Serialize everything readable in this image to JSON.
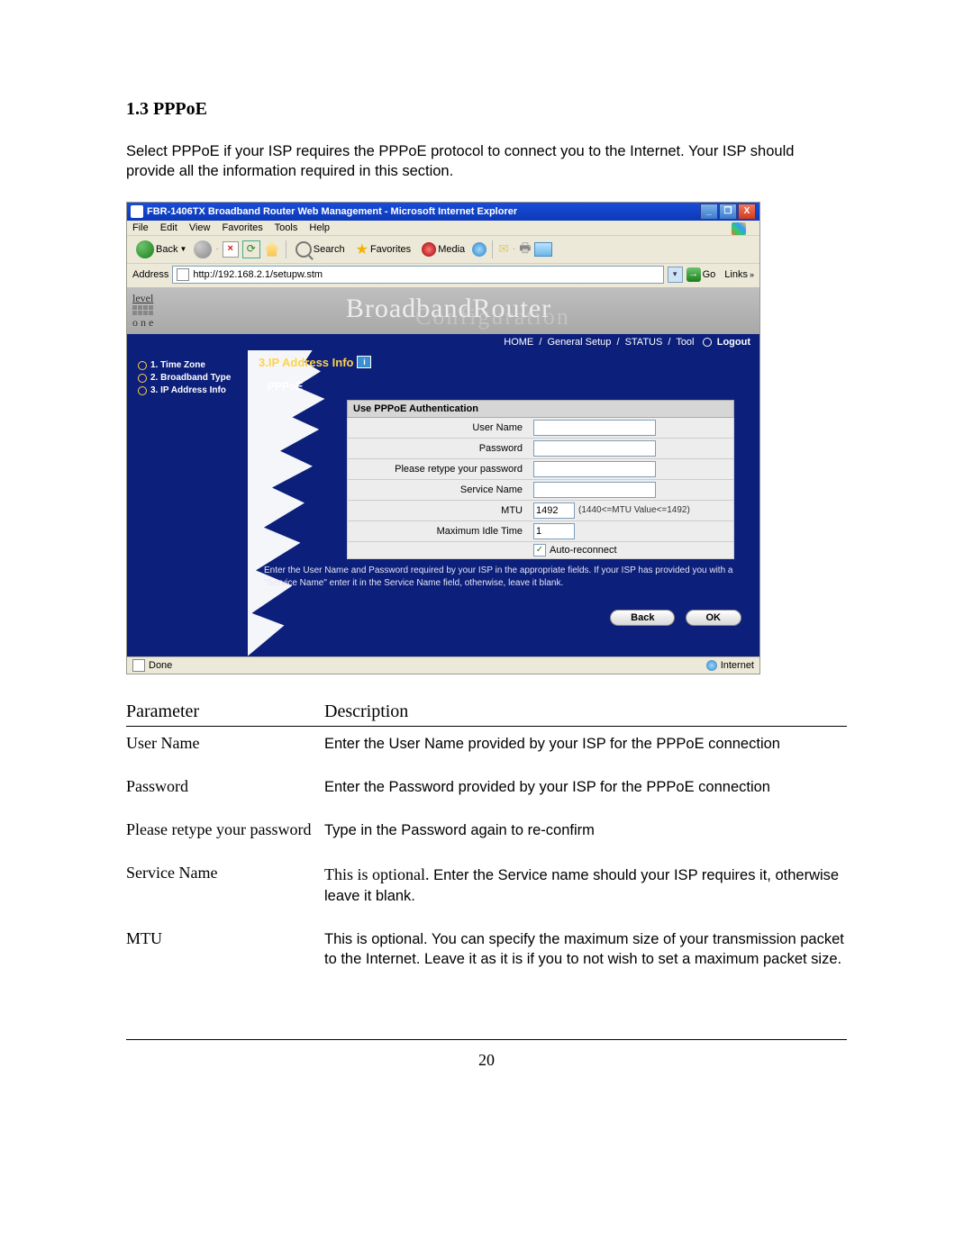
{
  "doc": {
    "section_heading": "1.3 PPPoE",
    "intro": "Select PPPoE if your ISP requires the PPPoE protocol to connect you to the Internet. Your ISP should provide all the information required in this section.",
    "page_number": "20"
  },
  "browser": {
    "title": "FBR-1406TX Broadband Router Web Management - Microsoft Internet Explorer",
    "menus": {
      "file": "File",
      "edit": "Edit",
      "view": "View",
      "favorites": "Favorites",
      "tools": "Tools",
      "help": "Help"
    },
    "toolbar": {
      "back": "Back",
      "search": "Search",
      "favorites": "Favorites",
      "media": "Media",
      "stop": "×",
      "refresh": "⟳",
      "go_arrow": "→"
    },
    "address_label": "Address",
    "address_value": "http://192.168.2.1/setupw.stm",
    "go": "Go",
    "links": "Links",
    "status_done": "Done",
    "status_zone": "Internet"
  },
  "router": {
    "brand_top": "level",
    "brand_bottom": "o n e",
    "banner_title": "BroadbandRouter",
    "banner_sub": "Configuration",
    "nav": {
      "home": "HOME",
      "general": "General Setup",
      "status": "STATUS",
      "tool": "Tool",
      "logout": "Logout"
    },
    "sidebar": {
      "items": [
        {
          "label": "1. Time Zone"
        },
        {
          "label": "2. Broadband Type"
        },
        {
          "label": "3. IP Address Info"
        }
      ]
    },
    "content": {
      "section_title": "3.IP Address Info",
      "help_badge": "i",
      "sub_heading": "PPPoE",
      "form_header": "Use PPPoE Authentication",
      "fields": {
        "user_name": {
          "label": "User Name",
          "value": ""
        },
        "password": {
          "label": "Password",
          "value": ""
        },
        "retype": {
          "label": "Please retype your password",
          "value": ""
        },
        "service_name": {
          "label": "Service Name",
          "value": ""
        },
        "mtu": {
          "label": "MTU",
          "value": "1492",
          "hint": "(1440<=MTU Value<=1492)"
        },
        "idle": {
          "label": "Maximum Idle Time",
          "value": "1"
        },
        "auto_reconnect": {
          "label": "Auto-reconnect",
          "checked": true
        }
      },
      "instruction": "Enter the User Name and Password required by your ISP in the appropriate fields. If your ISP has provided you with a \"Service Name\" enter it in the Service Name field, otherwise, leave it blank.",
      "buttons": {
        "back": "Back",
        "ok": "OK"
      }
    }
  },
  "param_table": {
    "head": {
      "param": "Parameter",
      "desc": "Description"
    },
    "rows": [
      {
        "param": "User Name",
        "desc": "Enter the User Name provided by your ISP for the PPPoE connection"
      },
      {
        "param": "Password",
        "desc": "Enter the Password provided by your ISP for the PPPoE connection"
      },
      {
        "param": "Please retype your password",
        "desc": "Type in the Password again to re-confirm"
      },
      {
        "param": "Service Name",
        "lead": "This is optional.",
        "desc": " Enter the Service name should your ISP requires it, otherwise leave it blank."
      },
      {
        "param": "MTU",
        "desc": "This is optional. You can specify the maximum size of your transmission packet to the Internet. Leave it as it is if you to not wish to set a maximum packet size."
      }
    ]
  }
}
